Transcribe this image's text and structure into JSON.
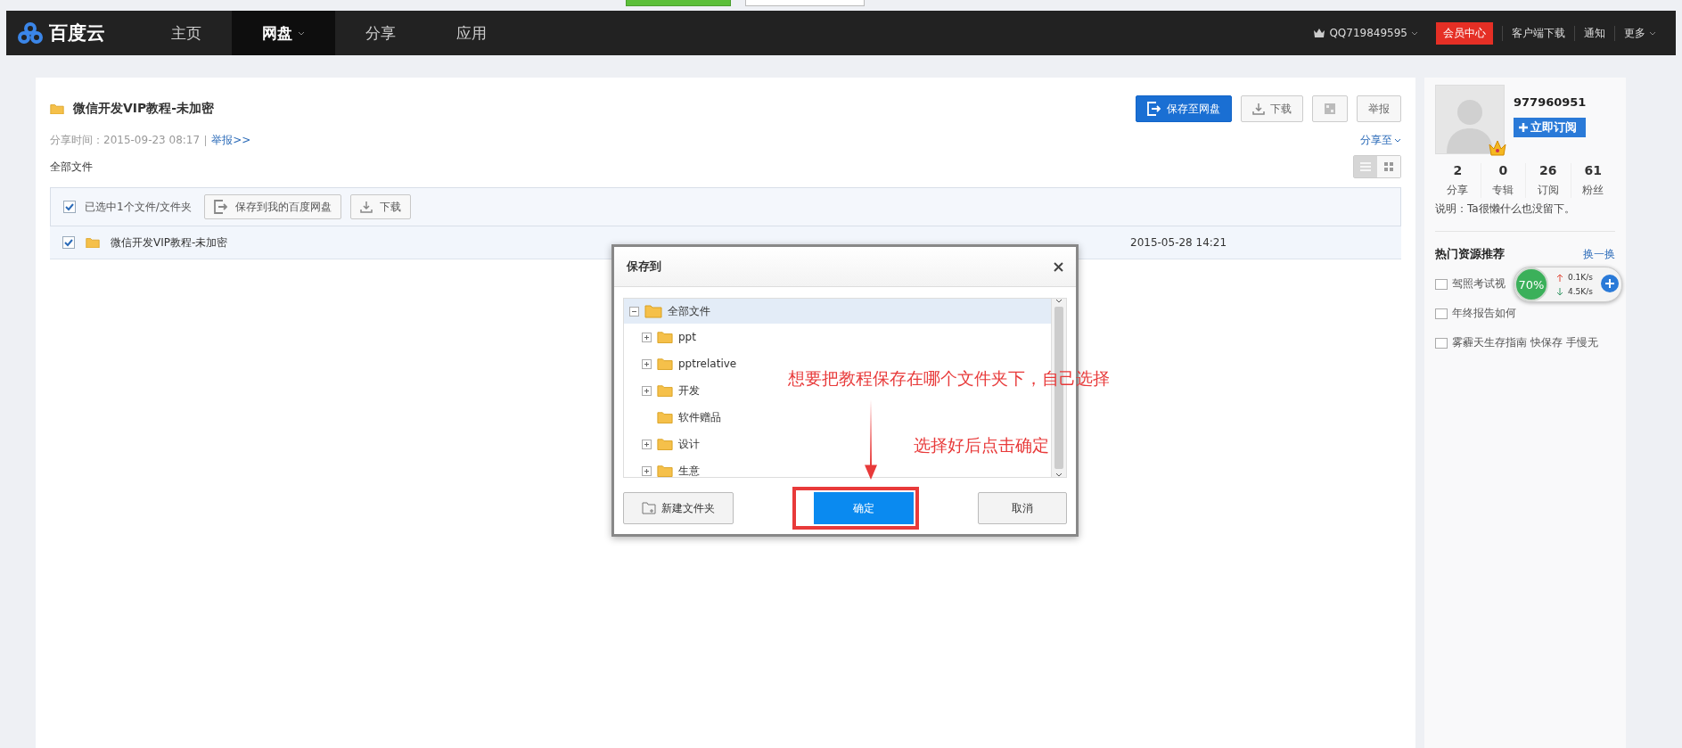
{
  "nav": {
    "logo": "百度云",
    "items": [
      {
        "label": "主页",
        "selected": false,
        "has_menu": false
      },
      {
        "label": "网盘",
        "selected": true,
        "has_menu": true
      },
      {
        "label": "分享",
        "selected": false,
        "has_menu": false
      },
      {
        "label": "应用",
        "selected": false,
        "has_menu": false
      }
    ],
    "account": "QQ719849595",
    "vip_button": "会员中心",
    "links": [
      "客户端下载",
      "通知"
    ],
    "more": "更多"
  },
  "share": {
    "title": "微信开发VIP教程-未加密",
    "share_time": "分享时间：2015-09-23 08:17",
    "report_link": "举报>>",
    "actions": [
      {
        "kind": "primary",
        "label": "保存至网盘"
      },
      {
        "kind": "download",
        "label": "下载"
      },
      {
        "kind": "qr"
      },
      {
        "kind": "plain",
        "label": "举报"
      }
    ],
    "share_to": "分享至",
    "breadcrumb": "全部文件",
    "views": [
      {
        "kind": "list",
        "selected": true
      },
      {
        "kind": "grid",
        "selected": false
      }
    ]
  },
  "file_list": {
    "select_all_checked": true,
    "selection_text": "已选中1个文件/文件夹",
    "toolbar_buttons": [
      {
        "kind": "save",
        "label": "保存到我的百度网盘"
      },
      {
        "kind": "download",
        "label": "下载"
      }
    ],
    "rows": [
      {
        "name": "微信开发VIP教程-未加密",
        "date": "2015-05-28 14:21",
        "checked": true
      }
    ]
  },
  "dialog": {
    "title": "保存到",
    "tree": {
      "label": "全部文件",
      "selected": true,
      "expanded": true,
      "children": [
        {
          "label": "ppt",
          "selected": false,
          "expandable": true
        },
        {
          "label": "pptrelative",
          "selected": false,
          "expandable": true
        },
        {
          "label": "开发",
          "selected": false,
          "expandable": true
        },
        {
          "label": "软件赠品",
          "selected": false,
          "expandable": false
        },
        {
          "label": "设计",
          "selected": false,
          "expandable": true
        },
        {
          "label": "生意",
          "selected": false,
          "expandable": true
        }
      ]
    },
    "new_folder": "新建文件夹",
    "confirm": "确定",
    "cancel": "取消"
  },
  "annotations": [
    "想要把教程保存在哪个文件夹下，自己选择",
    "选择好后点击确定"
  ],
  "profile": {
    "username": "977960951",
    "subscribe": "立即订阅",
    "stats": [
      {
        "value": "2",
        "label": "分享"
      },
      {
        "value": "0",
        "label": "专辑"
      },
      {
        "value": "26",
        "label": "订阅"
      },
      {
        "value": "61",
        "label": "粉丝"
      }
    ],
    "description": "说明：Ta很懒什么也没留下。"
  },
  "hot": {
    "title": "热门资源推荐",
    "refresh": "换一换",
    "items": [
      "驾照考试视",
      "年终报告如何",
      "雾霾天生存指南 快保存 手慢无"
    ]
  },
  "speed_widget": {
    "percent": "70%",
    "up": "0.1K/s",
    "down": "4.5K/s"
  }
}
